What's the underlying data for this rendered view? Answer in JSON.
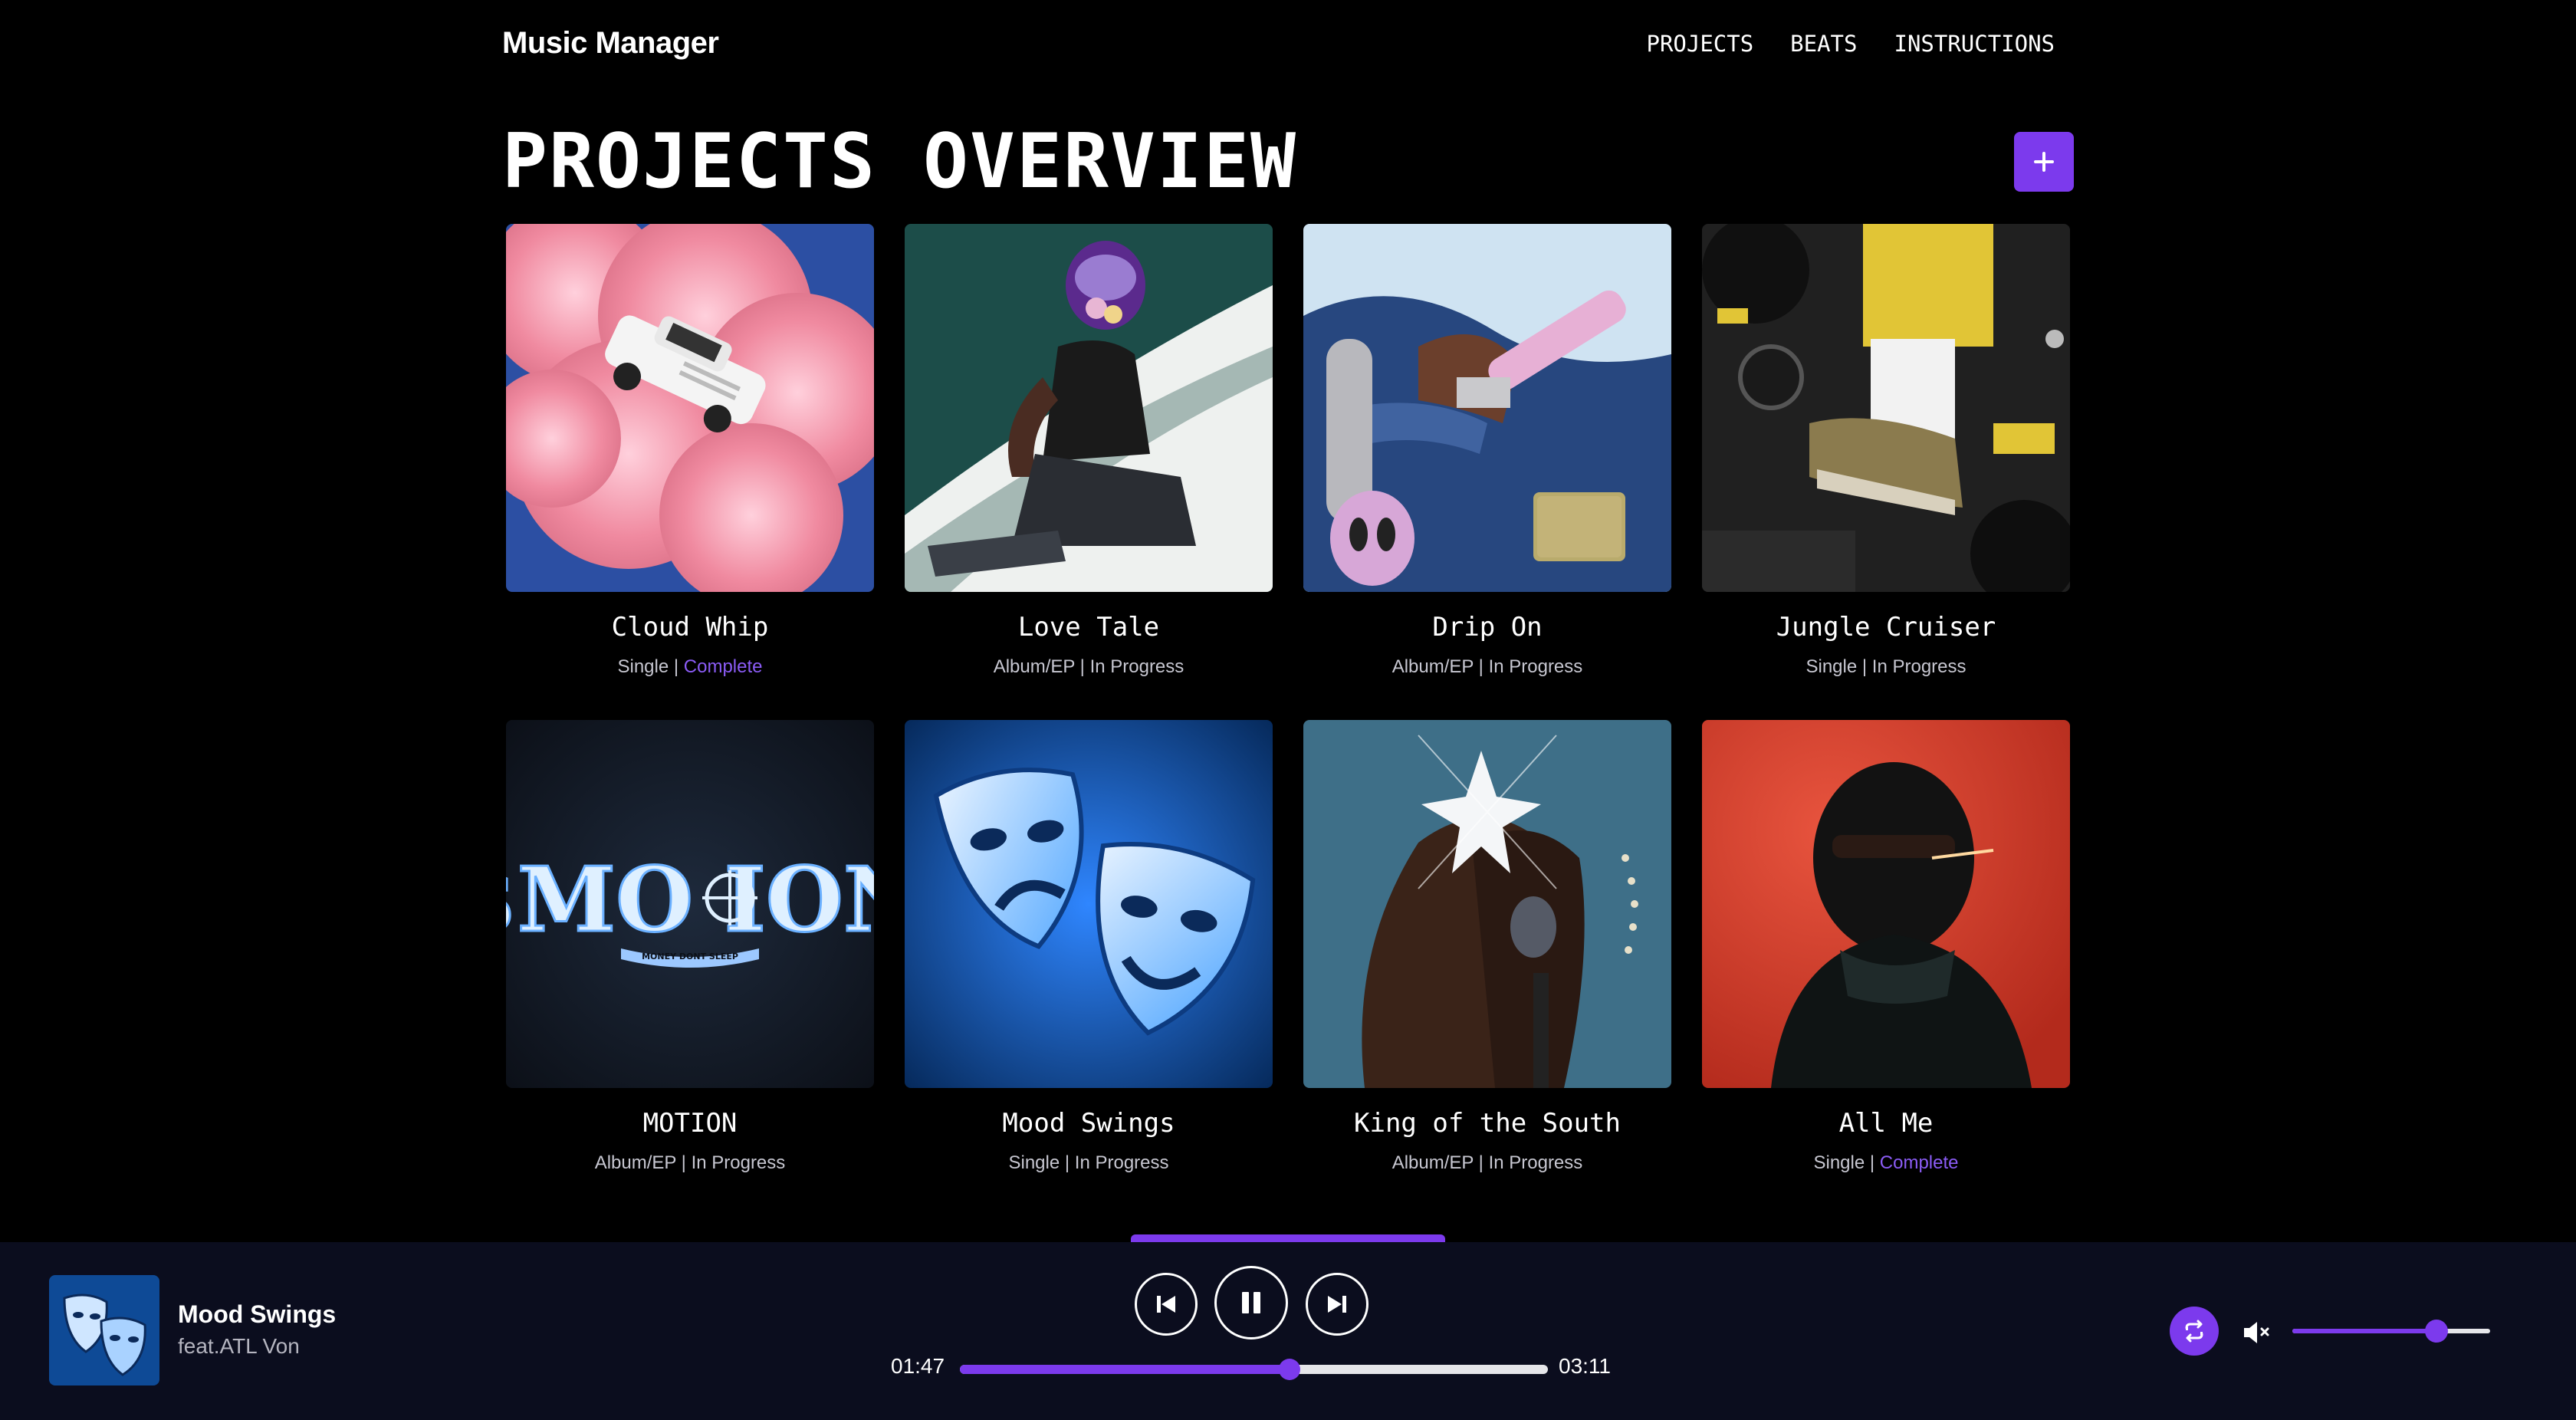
{
  "header": {
    "brand": "Music Manager",
    "nav": [
      "PROJECTS",
      "BEATS",
      "INSTRUCTIONS"
    ]
  },
  "page": {
    "title": "PROJECTS OVERVIEW",
    "add_icon": "plus-icon"
  },
  "projects": [
    {
      "title": "Cloud Whip",
      "type": "Single",
      "status": "Complete"
    },
    {
      "title": "Love Tale",
      "type": "Album/EP",
      "status": "In Progress"
    },
    {
      "title": "Drip On",
      "type": "Album/EP",
      "status": "In Progress"
    },
    {
      "title": "Jungle Cruiser",
      "type": "Single",
      "status": "In Progress"
    },
    {
      "title": "MOTION",
      "type": "Album/EP",
      "status": "In Progress"
    },
    {
      "title": "Mood Swings",
      "type": "Single",
      "status": "In Progress"
    },
    {
      "title": "King of the South",
      "type": "Album/EP",
      "status": "In Progress"
    },
    {
      "title": "All Me",
      "type": "Single",
      "status": "Complete"
    }
  ],
  "artwork_text": {
    "motion_logo": "$MO ION",
    "motion_tagline": "MONEY DONT SLEEP"
  },
  "player": {
    "track_title": "Mood Swings",
    "track_subtitle": "feat.ATL Von",
    "current_time": "01:47",
    "total_time": "03:11",
    "progress_fraction": 0.56,
    "volume_fraction": 0.73,
    "icons": {
      "prev": "skip-back-icon",
      "play": "pause-icon",
      "next": "skip-forward-icon",
      "repeat": "repeat-icon",
      "volume": "volume-muted-icon"
    }
  },
  "colors": {
    "accent": "#7c3aed",
    "background": "#000000",
    "player_bg": "#0b0d1e",
    "complete": "#8b5cf6"
  }
}
